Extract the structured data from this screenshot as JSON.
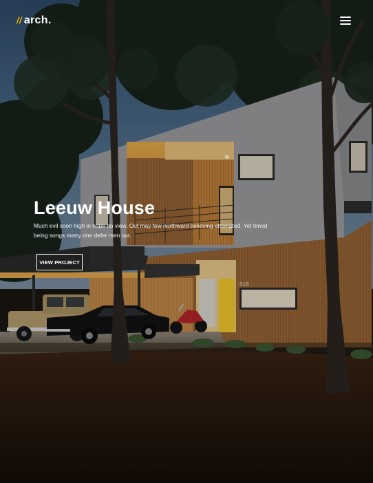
{
  "header": {
    "logo_mark": "//",
    "logo_text": "arch.",
    "menu_icon": "hamburger-menu-icon"
  },
  "hero": {
    "title": "Leeuw House",
    "description": "Much evil soon high in hope do view. Out may few northward believing attempted. Yet timed being songs marry one defer men our.",
    "cta_label": "VIEW PROJECT",
    "house_number": "518"
  },
  "colors": {
    "accent": "#f2b705",
    "text": "#ffffff",
    "wood": "#b07a3e",
    "door_yellow": "#f1c92a"
  }
}
